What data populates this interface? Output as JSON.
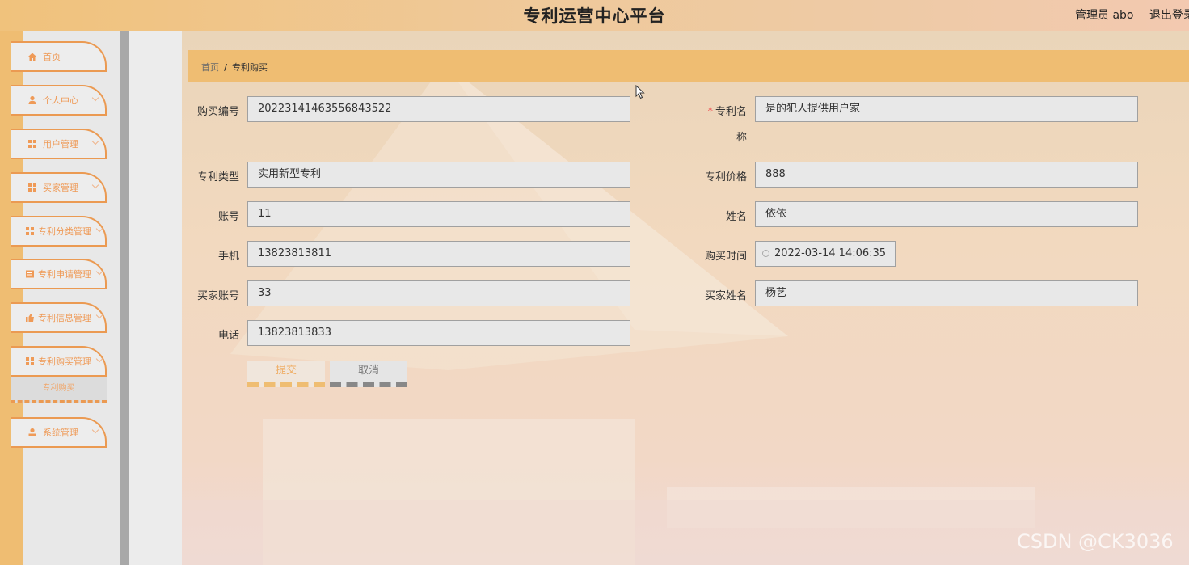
{
  "header": {
    "title": "专利运营中心平台",
    "user": "管理员 abo",
    "logout": "退出登录"
  },
  "sidebar": {
    "items": [
      {
        "label": "首页",
        "icon": "home-icon"
      },
      {
        "label": "个人中心",
        "icon": "user-icon"
      },
      {
        "label": "用户管理",
        "icon": "grid-icon"
      },
      {
        "label": "买家管理",
        "icon": "grid-icon"
      },
      {
        "label": "专利分类管理",
        "icon": "grid-icon"
      },
      {
        "label": "专利申请管理",
        "icon": "doc-icon"
      },
      {
        "label": "专利信息管理",
        "icon": "thumb-icon"
      },
      {
        "label": "专利购买管理",
        "icon": "grid-icon"
      },
      {
        "label": "系统管理",
        "icon": "person-icon"
      }
    ],
    "sub_item": "专利购买"
  },
  "breadcrumb": {
    "home": "首页",
    "separator": "/",
    "current": "专利购买"
  },
  "form": {
    "purchase_no": {
      "label": "购买编号",
      "value": "20223141463556843522"
    },
    "patent_name": {
      "label_1": "专利名",
      "label_2": "称",
      "value": "是的犯人提供用户家"
    },
    "patent_type": {
      "label": "专利类型",
      "value": "实用新型专利"
    },
    "patent_price": {
      "label": "专利价格",
      "value": "888"
    },
    "account": {
      "label": "账号",
      "value": "11"
    },
    "name": {
      "label": "姓名",
      "value": "依依"
    },
    "phone": {
      "label": "手机",
      "value": "13823813811"
    },
    "purchase_time": {
      "label": "购买时间",
      "value": "2022-03-14 14:06:35"
    },
    "buyer_account": {
      "label": "买家账号",
      "value": "33"
    },
    "buyer_name": {
      "label": "买家姓名",
      "value": "杨艺"
    },
    "tel": {
      "label": "电话",
      "value": "13823813833"
    }
  },
  "buttons": {
    "submit": "提交",
    "cancel": "取消"
  },
  "watermark": "CSDN @CK3036",
  "colors": {
    "accent": "#efbd72",
    "menu_border": "#eb9a52",
    "menu_text": "#ef9a57"
  }
}
